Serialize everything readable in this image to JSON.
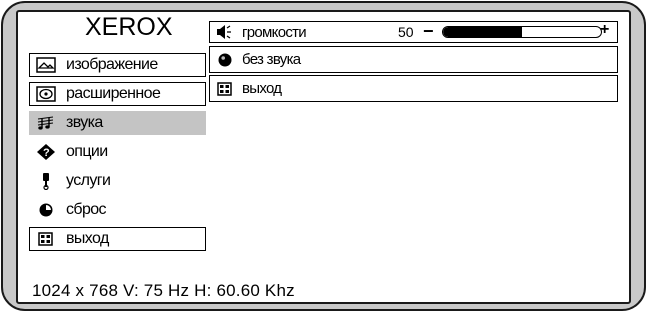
{
  "brand": {
    "logo": "XEROX"
  },
  "menu": {
    "items": [
      {
        "label": "изображение",
        "icon": "picture-icon",
        "selected": false,
        "boxed": true
      },
      {
        "label": "расширенное",
        "icon": "disc-icon",
        "selected": false,
        "boxed": true
      },
      {
        "label": "звука",
        "icon": "music-note-icon",
        "selected": true,
        "boxed": false
      },
      {
        "label": "опции",
        "icon": "diamond-question-icon",
        "selected": false,
        "boxed": false
      },
      {
        "label": "услуги",
        "icon": "wrench-icon",
        "selected": false,
        "boxed": false
      },
      {
        "label": "сброс",
        "icon": "reset-circle-icon",
        "selected": false,
        "boxed": false
      },
      {
        "label": "выход",
        "icon": "exit-grid-icon",
        "selected": false,
        "boxed": true
      }
    ]
  },
  "sound_submenu": {
    "volume": {
      "label": "громкости",
      "value": "50",
      "level": 0.5,
      "minus": "−",
      "plus": "+",
      "icon": "speaker-icon"
    },
    "mute": {
      "label": "без звука",
      "icon": "radio-dot-icon"
    },
    "exit": {
      "label": "выход",
      "icon": "exit-grid-icon"
    }
  },
  "status": {
    "text": "1024 x 768 V: 75 Hz   H: 60.60 Khz"
  },
  "colors": {
    "bezel": "#c9c9c9",
    "selected_bg": "#c4c4c4",
    "screen_bg": "#ffffff"
  }
}
